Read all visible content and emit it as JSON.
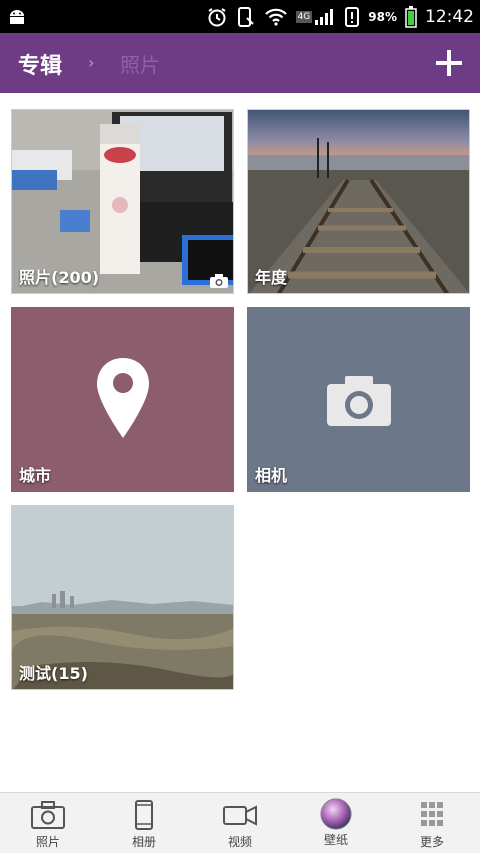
{
  "status_bar": {
    "network": "4G",
    "battery": "98%",
    "time": "12:42"
  },
  "header": {
    "breadcrumb_root": "专辑",
    "breadcrumb_sep": "›",
    "breadcrumb_current": "照片",
    "accent_color": "#6e3b85"
  },
  "albums": [
    {
      "label": "照片(200)",
      "badge_icon": "camera-icon"
    },
    {
      "label": "年度"
    },
    {
      "label": "城市",
      "icon": "location-pin-icon",
      "color": "#8c5d6c"
    },
    {
      "label": "相机",
      "icon": "camera-icon",
      "color": "#6c7789"
    },
    {
      "label": "测试(15)"
    }
  ],
  "bottom_nav": [
    {
      "label": "照片",
      "icon": "camera-icon"
    },
    {
      "label": "相册",
      "icon": "phone-icon"
    },
    {
      "label": "视频",
      "icon": "video-icon"
    },
    {
      "label": "壁纸",
      "icon": "wallpaper-icon"
    },
    {
      "label": "更多",
      "icon": "grid-icon"
    }
  ]
}
